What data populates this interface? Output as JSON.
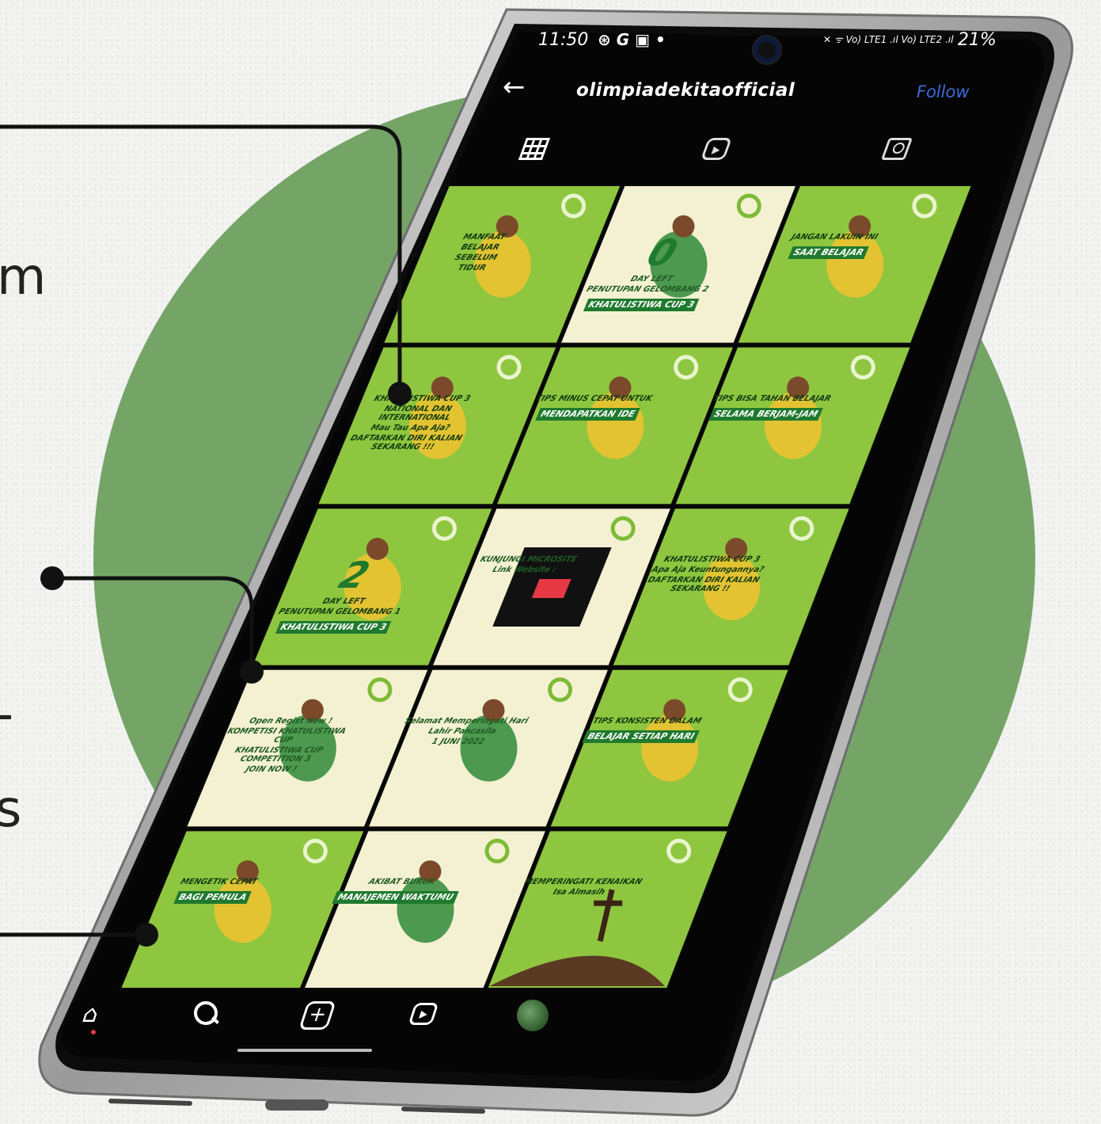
{
  "status_bar": {
    "time": "11:50",
    "left_icons": "⊛ G ▣ •",
    "right_icons": "✕ ᯤ Vo) LTE1 .ıl Vo) LTE2 .ıl",
    "battery": "21%"
  },
  "header": {
    "back_icon": "back-arrow-icon",
    "username": "olimpiadekitaofficial",
    "follow_label": "Follow"
  },
  "profile_tabs": [
    {
      "name": "grid-icon"
    },
    {
      "name": "reels-icon"
    },
    {
      "name": "tagged-icon"
    }
  ],
  "posts": [
    {
      "lines": [
        "MANFAAT",
        "BELAJAR",
        "SEBELUM",
        "TIDUR"
      ],
      "style": "left-title"
    },
    {
      "lines": [
        "0",
        "DAY LEFT",
        "PENUTUPAN GELOMBANG 2",
        "KHATULISTIWA CUP 3"
      ],
      "style": "countdown"
    },
    {
      "lines": [
        "JANGAN LAKUIN INI",
        "SAAT BELAJAR"
      ],
      "style": "bottom-title"
    },
    {
      "lines": [
        "KHATULISTIWA CUP 3",
        "NATIONAL DAN INTERNATIONAL",
        "Mau Tau Apa Aja?",
        "DAFTARKAN DIRI KALIAN SEKARANG !!!"
      ],
      "style": "event"
    },
    {
      "lines": [
        "TIPS MINUS CEPAT UNTUK",
        "MENDAPATKAN IDE"
      ],
      "style": "bottom-title"
    },
    {
      "lines": [
        "TIPS BISA TAHAN BELAJAR",
        "SELAMA BERJAM-JAM"
      ],
      "style": "bottom-title"
    },
    {
      "lines": [
        "2",
        "DAY LEFT",
        "PENUTUPAN GELOMBANG 1",
        "KHATULISTIWA CUP 3"
      ],
      "style": "countdown"
    },
    {
      "lines": [
        "KUNJUNGI MICROSITE",
        "Link Website :"
      ],
      "style": "qr"
    },
    {
      "lines": [
        "KHATULISTIWA CUP 3",
        "Apa Aja Keuntungannya?",
        "DAFTARKAN DIRI KALIAN SEKARANG !!"
      ],
      "style": "event"
    },
    {
      "lines": [
        "Open Regist Now !",
        "KOMPETISI KHATULISTIWA CUP",
        "KHATULISTIWA CUP COMPETITION 3",
        "JOIN NOW !"
      ],
      "style": "event"
    },
    {
      "lines": [
        "Selamat Memperingati Hari",
        "Lahir Pancasila",
        "1 JUNI 2022"
      ],
      "style": "pancasila"
    },
    {
      "lines": [
        "TIPS KONSISTEN DALAM",
        "BELAJAR SETIAP HARI"
      ],
      "style": "bottom-title"
    },
    {
      "lines": [
        "MENGETIK CEPAT",
        "BAGI PEMULA"
      ],
      "style": "bottom-title"
    },
    {
      "lines": [
        "AKIBAT BURUK",
        "MANAJEMEN WAKTUMU"
      ],
      "style": "bottom-title"
    },
    {
      "lines": [
        "MEMPERINGATI KENAIKAN",
        "Isa Almasih"
      ],
      "style": "cross"
    }
  ],
  "bottom_nav": [
    {
      "name": "home-icon"
    },
    {
      "name": "search-icon"
    },
    {
      "name": "create-icon"
    },
    {
      "name": "reels-nav-icon"
    },
    {
      "name": "profile-avatar"
    }
  ],
  "side_text": {
    "top_fragment": "m",
    "middle_fragment": "-",
    "bottom_fragment": "s"
  },
  "colors": {
    "post_green": "#8fc63f",
    "post_cream": "#f4f1d2",
    "accent_dark_green": "#1f7a2e",
    "circle": "#74a567",
    "follow_blue": "#3b6bd6"
  }
}
